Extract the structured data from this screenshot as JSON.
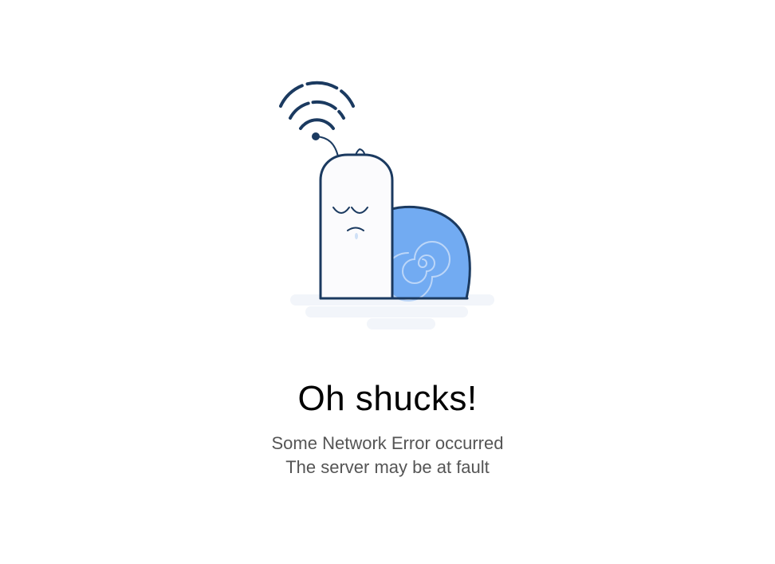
{
  "error": {
    "title": "Oh shucks!",
    "lines": [
      "Some Network Error occurred",
      "The server may be at fault"
    ]
  },
  "illustration": {
    "icon": "sad-snail-wifi-illustration",
    "colors": {
      "outline": "#1b3a60",
      "shell": "#72abf2",
      "body": "#fbfbfd",
      "shadow": "#f2f5fa"
    }
  }
}
